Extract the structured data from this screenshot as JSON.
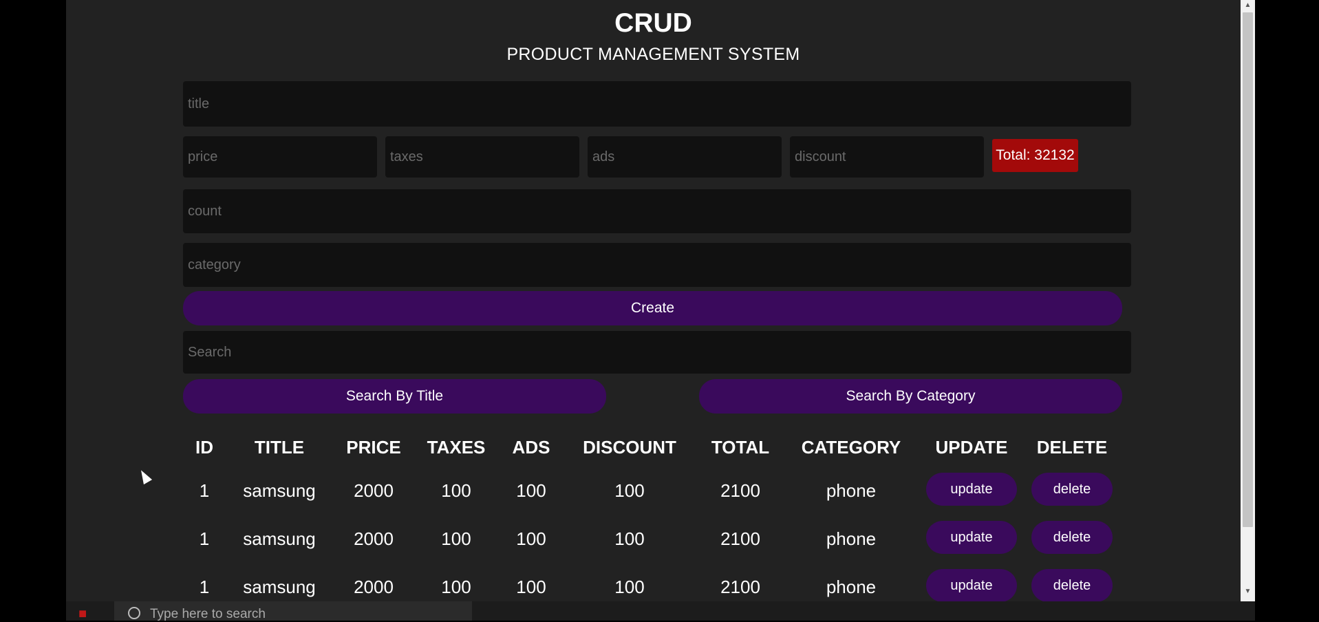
{
  "header": {
    "title": "CRUD",
    "subtitle": "PRODUCT MANAGEMENT SYSTEM"
  },
  "form": {
    "title_placeholder": "title",
    "price_placeholder": "price",
    "taxes_placeholder": "taxes",
    "ads_placeholder": "ads",
    "discount_placeholder": "discount",
    "total_label": "Total: 32132",
    "count_placeholder": "count",
    "category_placeholder": "category",
    "create_label": "Create"
  },
  "search": {
    "placeholder": "Search",
    "by_title_label": "Search By Title",
    "by_category_label": "Search By Category"
  },
  "table": {
    "headers": [
      "ID",
      "TITLE",
      "PRICE",
      "TAXES",
      "ADS",
      "DISCOUNT",
      "TOTAL",
      "CATEGORY",
      "UPDATE",
      "DELETE"
    ],
    "rows": [
      {
        "id": "1",
        "title": "samsung",
        "price": "2000",
        "taxes": "100",
        "ads": "100",
        "discount": "100",
        "total": "2100",
        "category": "phone",
        "update": "update",
        "delete": "delete"
      },
      {
        "id": "1",
        "title": "samsung",
        "price": "2000",
        "taxes": "100",
        "ads": "100",
        "discount": "100",
        "total": "2100",
        "category": "phone",
        "update": "update",
        "delete": "delete"
      },
      {
        "id": "1",
        "title": "samsung",
        "price": "2000",
        "taxes": "100",
        "ads": "100",
        "discount": "100",
        "total": "2100",
        "category": "phone",
        "update": "update",
        "delete": "delete"
      }
    ]
  },
  "taskbar": {
    "search_placeholder": "Type here to search"
  },
  "colors": {
    "background": "#222222",
    "input": "#111111",
    "accent": "#3a0a5c",
    "total_badge": "#a30a0a"
  }
}
